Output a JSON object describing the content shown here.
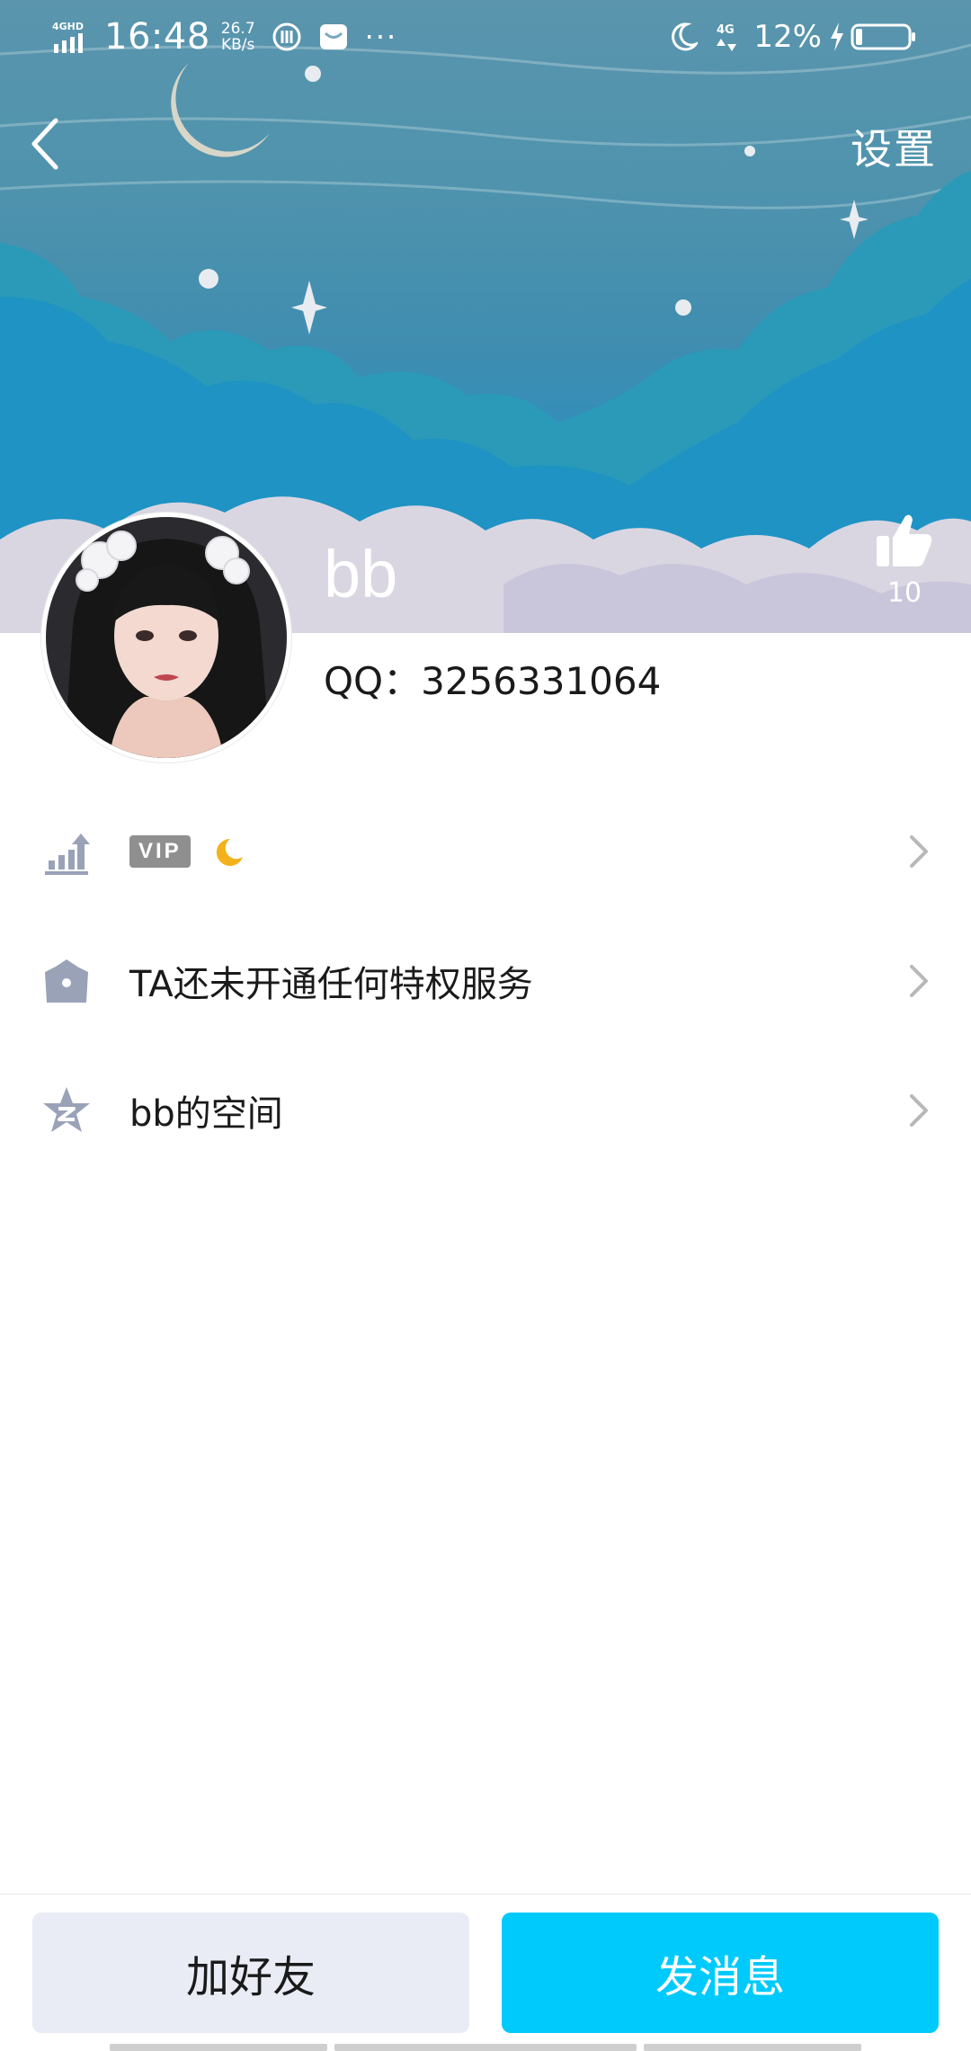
{
  "status_bar": {
    "network": "4GHD",
    "time": "16:48",
    "speed_value": "26.7",
    "speed_unit": "KB/s",
    "extra": "···",
    "mobile": "4G",
    "battery_percent": "12%"
  },
  "nav": {
    "settings_label": "设置"
  },
  "profile": {
    "nickname": "bb",
    "likes": "10",
    "qq_line": "QQ：3256331064"
  },
  "rows": [
    {
      "id": "vip",
      "badge": "VIP",
      "icon": "level-up-icon"
    },
    {
      "id": "privilege",
      "label": "TA还未开通任何特权服务",
      "icon": "crown-icon"
    },
    {
      "id": "space",
      "label": "bb的空间",
      "icon": "qzone-star-icon"
    }
  ],
  "buttons": {
    "add_friend": "加好友",
    "send_message": "发消息"
  },
  "colors": {
    "accent": "#00cafc",
    "secondary_button": "#e9ecf4",
    "icon_gray": "#9aa2b8"
  }
}
